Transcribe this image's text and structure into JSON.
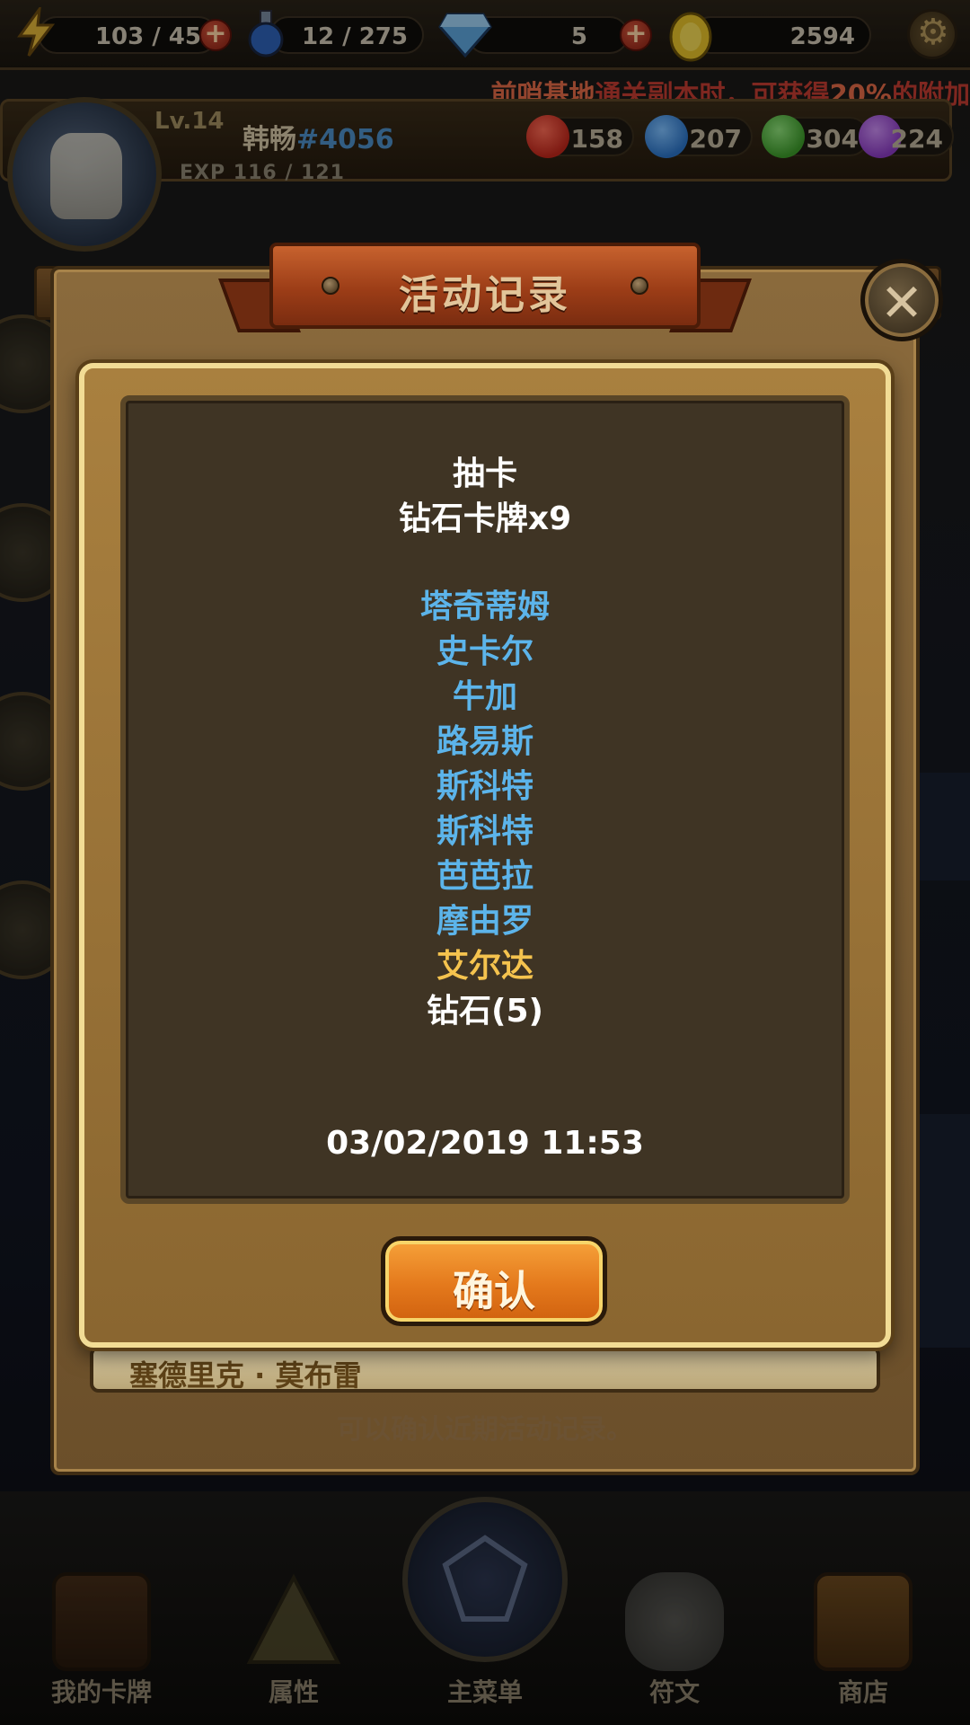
{
  "topbar": {
    "stamina": "103 / 45",
    "potion": "12 / 275",
    "diamonds": "5",
    "gold": "2594"
  },
  "announcement": {
    "highlight1": "前哨基地",
    "text1": "通关副本时，可获得",
    "highlight2": "20%",
    "text2": "的附加"
  },
  "player": {
    "level": "Lv.14",
    "name": "韩畅",
    "tag": "#4056",
    "exp": "EXP  116 / 121",
    "gems": [
      {
        "color": "#c0271b",
        "count": "158"
      },
      {
        "color": "#2b73c6",
        "count": "207"
      },
      {
        "color": "#3c9a2a",
        "count": "304"
      },
      {
        "color": "#8a3bc2",
        "count": "224"
      }
    ]
  },
  "panel": {
    "title": "活动记录",
    "close_icon": "close-icon",
    "nameplate": "塞德里克 · 莫布雷",
    "hint": "可以确认近期活动记录。"
  },
  "dialog": {
    "header1": "抽卡",
    "header2": "钻石卡牌x9",
    "cards": [
      {
        "name": "塔奇蒂姆",
        "rarity": "blue"
      },
      {
        "name": "史卡尔",
        "rarity": "blue"
      },
      {
        "name": "牛加",
        "rarity": "blue"
      },
      {
        "name": "路易斯",
        "rarity": "blue"
      },
      {
        "name": "斯科特",
        "rarity": "blue"
      },
      {
        "name": "斯科特",
        "rarity": "blue"
      },
      {
        "name": "芭芭拉",
        "rarity": "blue"
      },
      {
        "name": "摩由罗",
        "rarity": "blue"
      },
      {
        "name": "艾尔达",
        "rarity": "gold"
      }
    ],
    "bonus": "钻石(5)",
    "timestamp": "03/02/2019 11:53",
    "confirm_label": "确认"
  },
  "bottom_nav": [
    {
      "label": "我的卡牌"
    },
    {
      "label": "属性"
    },
    {
      "label": "主菜单"
    },
    {
      "label": "符文"
    },
    {
      "label": "商店"
    }
  ]
}
